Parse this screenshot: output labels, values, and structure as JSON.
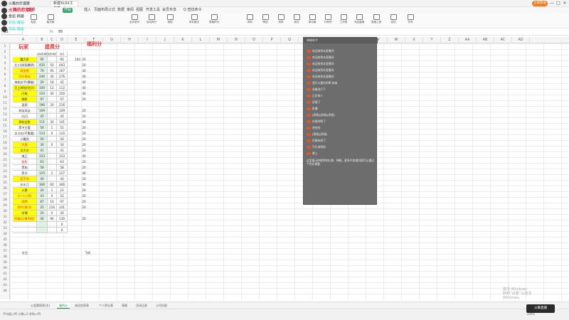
{
  "window": {
    "doc_tab_label": "新建XLSX工作表.xlsx",
    "login_label": "立即登录",
    "min_glyph": "—",
    "max_glyph": "□",
    "close_glyph": "✕"
  },
  "menu": {
    "start_label": "开始",
    "items": [
      "文件",
      "插入",
      "页面布局",
      "公式",
      "数据",
      "审阅",
      "视图",
      "开发工具",
      "会员专享",
      "Q 查找命令"
    ]
  },
  "ribbon": {
    "items": [
      "粘贴",
      "格式刷",
      "合并居中",
      "自动换行",
      "常规",
      "条件格式",
      "表格样式",
      "求和",
      "筛选",
      "排序",
      "填充",
      "单元格",
      "行和列",
      "工作表",
      "冻结窗格",
      "表格工具",
      "查找",
      "符号"
    ]
  },
  "formula": {
    "cell_ref": "B3",
    "fx": "fx",
    "value": "95"
  },
  "stream": {
    "rows": [
      {
        "text": "火舞的炊烟雾",
        "style": ""
      },
      {
        "text": "火舞的炊烟妖",
        "style": "hl"
      },
      {
        "text": "金凯·韩珊",
        "style": ""
      },
      {
        "text": "可乐·再玩·",
        "style": "cy"
      },
      {
        "text": "可乐 再玩",
        "style": "cy"
      }
    ]
  },
  "columns": [
    "A",
    "B",
    "C",
    "D",
    "E",
    "F",
    "G",
    "H",
    "I",
    "J",
    "K",
    "L",
    "M",
    "N",
    "O",
    "P",
    "Q",
    "R",
    "S",
    "T",
    "U",
    "V",
    "W",
    "X",
    "Y",
    "Z",
    "AA",
    "AB",
    "AC",
    "AD"
  ],
  "sheet": {
    "title_players": "玩家",
    "title_fee": "建费分",
    "title_bonus": "福利分",
    "subheaders": [
      "总建费消费分",
      "建费消费分",
      "直付"
    ],
    "rows": [
      {
        "name": "魔大彩",
        "b": "95",
        "c": "",
        "d": "95",
        "e": "100",
        "f": "20",
        "yellow": true,
        "red": false
      },
      {
        "name": "左川(原版爆明)",
        "b": "435",
        "c": "50",
        "d": "493",
        "e": "",
        "f": "20",
        "yellow": false,
        "red": false
      },
      {
        "name": "高加恩",
        "b": "79",
        "c": "95",
        "d": "167",
        "e": "",
        "f": "40",
        "yellow": true,
        "red": true
      },
      {
        "name": "可乐再玩",
        "b": "246",
        "c": "30",
        "d": "276",
        "e": "",
        "f": "40",
        "yellow": true,
        "red": true
      },
      {
        "name": "神机妙手(爆破)",
        "b": "20",
        "c": "18",
        "d": "42",
        "e": "",
        "f": "40",
        "yellow": false,
        "red": false
      },
      {
        "name": "天上掉馅(钻头)",
        "b": "100",
        "c": "12",
        "d": "112",
        "e": "",
        "f": "40",
        "yellow": true,
        "red": false
      },
      {
        "name": "闪电",
        "b": "110",
        "c": "40",
        "d": "150",
        "e": "",
        "f": "40",
        "yellow": true,
        "red": false
      },
      {
        "name": "佛影",
        "b": "97",
        "c": "",
        "d": "97",
        "e": "",
        "f": "20",
        "yellow": true,
        "red": false
      },
      {
        "name": "温柔",
        "b": "196",
        "c": "20",
        "d": "216",
        "e": "",
        "f": "",
        "yellow": false,
        "red": false
      },
      {
        "name": "林浩风云",
        "b": "109",
        "c": "",
        "d": "109",
        "e": "",
        "f": "20",
        "yellow": false,
        "red": false
      },
      {
        "name": "闪闪",
        "b": "45",
        "c": "",
        "d": "45",
        "e": "",
        "f": "20",
        "yellow": false,
        "red": false
      },
      {
        "name": "青蛙白影",
        "b": "111",
        "c": "30",
        "d": "141",
        "e": "",
        "f": "40",
        "yellow": true,
        "red": false
      },
      {
        "name": "黑子主管",
        "b": "50",
        "c": "1",
        "d": "51",
        "e": "",
        "f": "20",
        "yellow": false,
        "red": false
      },
      {
        "name": "炎卡拉(不需要)",
        "b": "110",
        "c": "0",
        "d": "110",
        "e": "",
        "f": "20",
        "yellow": false,
        "red": false
      },
      {
        "name": "小魔女",
        "b": "50",
        "c": "",
        "d": "50",
        "e": "",
        "f": "20",
        "yellow": false,
        "red": false
      },
      {
        "name": "大量",
        "b": "30",
        "c": "0",
        "d": "30",
        "e": "",
        "f": "20",
        "yellow": true,
        "red": true
      },
      {
        "name": "见大灾",
        "b": "41",
        "c": "",
        "d": "41",
        "e": "",
        "f": "20",
        "yellow": true,
        "red": false
      },
      {
        "name": "魂王",
        "b": "153",
        "c": "",
        "d": "153",
        "e": "",
        "f": "40",
        "yellow": false,
        "red": false
      },
      {
        "name": "猫影",
        "b": "63",
        "c": "",
        "d": "63",
        "e": "",
        "f": "20",
        "yellow": false,
        "red": true
      },
      {
        "name": "黑狗",
        "b": "58",
        "c": "",
        "d": "58",
        "e": "",
        "f": "20",
        "yellow": false,
        "red": false
      },
      {
        "name": "黑羊",
        "b": "125",
        "c": "2",
        "d": "127",
        "e": "",
        "f": "40",
        "yellow": false,
        "red": false
      },
      {
        "name": "蓝不凉",
        "b": "40",
        "c": "",
        "d": "40",
        "e": "",
        "f": "20",
        "yellow": true,
        "red": true
      },
      {
        "name": "水水汀",
        "b": "306",
        "c": "60",
        "d": "366",
        "e": "",
        "f": "40",
        "yellow": false,
        "red": false
      },
      {
        "name": "火舞",
        "b": "20",
        "c": "1",
        "d": "21",
        "e": "",
        "f": "20",
        "yellow": true,
        "red": false
      },
      {
        "name": "十一(八四)",
        "b": "43",
        "c": "9",
        "d": "52",
        "e": "",
        "f": "20",
        "yellow": true,
        "red": true
      },
      {
        "name": "酒喝",
        "b": "87",
        "c": "10",
        "d": "97",
        "e": "",
        "f": "20",
        "yellow": true,
        "red": true
      },
      {
        "name": "雨竹(黄河)",
        "b": "25",
        "c": "216",
        "d": "241",
        "e": "",
        "f": "20",
        "yellow": true,
        "red": true
      },
      {
        "name": "凉薄",
        "b": "20",
        "c": "0",
        "d": "20",
        "e": "",
        "f": "",
        "yellow": true,
        "red": false
      },
      {
        "name": "四级长(夏明程)",
        "b": "40",
        "c": "90",
        "d": "130",
        "e": "",
        "f": "20",
        "yellow": true,
        "red": true
      },
      {
        "name": "",
        "b": "",
        "c": "",
        "d": "0",
        "e": "",
        "f": "",
        "yellow": false,
        "red": false
      },
      {
        "name": "",
        "b": "",
        "c": "",
        "d": "0",
        "e": "",
        "f": "",
        "yellow": false,
        "red": false
      }
    ],
    "note_a": "长生",
    "note_f": "飞机"
  },
  "chat": {
    "title": "弹幕助手",
    "messages": [
      {
        "name": "",
        "text": "欢迎来到本直播间"
      },
      {
        "name": "",
        "text": "欢迎来到本直播间"
      },
      {
        "name": "",
        "text": "欢迎来到本直播间"
      },
      {
        "name": "",
        "text": "欢迎来到本直播间"
      },
      {
        "name": "",
        "text": "欢迎来到本直播间"
      },
      {
        "name": "",
        "text": "我可以看别的啊 妹妹"
      },
      {
        "name": "",
        "text": "说着说打下"
      },
      {
        "name": "",
        "text": "正好来八"
      },
      {
        "name": "",
        "text": "好骚了"
      },
      {
        "name": "",
        "text": "卧槽"
      },
      {
        "name": "",
        "text": "[表情][表情][表情]"
      },
      {
        "name": "",
        "text": "好骚的啊了"
      },
      {
        "name": "",
        "text": "哈哈哈"
      },
      {
        "name": "",
        "text": "[表情][表情]"
      },
      {
        "name": "",
        "text": "好骚有病了"
      },
      {
        "name": "",
        "text": "可乐来啦啦"
      },
      {
        "name": "",
        "text": "晚上"
      }
    ],
    "system_note": "这里展示你收到的礼物、弹幕，更多不违规内容可以通过个性化调整"
  },
  "tabs": {
    "items": [
      "公会赛程表(主)",
      "福利分",
      "成员信息表",
      "个人积分表",
      "表格",
      "活动记录",
      "公司分配"
    ],
    "active_index": 1
  },
  "status": {
    "text": "平均值=95 计数=2 求和=95",
    "zoom": "100%"
  },
  "watermark": {
    "line1": "激活 Windows",
    "line2": "转到“设置”以激活 Windows。"
  },
  "corner": {
    "label": "火舞直播"
  }
}
